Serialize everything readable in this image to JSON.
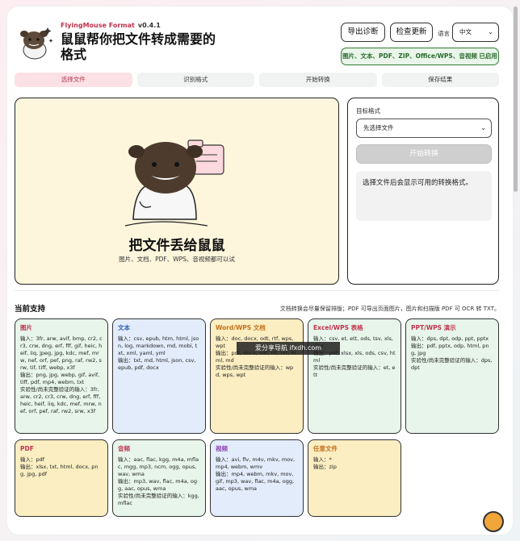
{
  "app": {
    "name": "FlyingMouse Format",
    "version": "v0.4.1",
    "headline": "鼠鼠帮你把文件转成需要的格式"
  },
  "header": {
    "export_label": "导出诊断",
    "update_label": "检查更新",
    "language_label": "语言",
    "language_value": "中文",
    "status": "图片、文本、PDF、ZIP、Office/WPS、音视频 已启用"
  },
  "steps": [
    "选择文件",
    "识别格式",
    "开始转换",
    "保存结果"
  ],
  "dropzone": {
    "title": "把文件丢给鼠鼠",
    "subtitle": "图片、文档、PDF、WPS、音视频都可以试"
  },
  "side": {
    "target_label": "目标格式",
    "select_placeholder": "先选择文件",
    "start_label": "开始转换",
    "hint": "选择文件后会显示可用的转换格式。"
  },
  "support": {
    "title": "当前支持",
    "note": "文档转换会尽量保留排版；PDF 可导出页面图片，图片和扫描版 PDF 可 OCR 转 TXT。",
    "cards": [
      {
        "title": "图片",
        "input": "输入：3fr, arw, avif, bmp, cr2, cr3, crw, dng, erf, fff, gif, heic, heif, iiq, jpeg, jpg, kdc, mef, mrw, nef, orf, pef, png, raf, rw2, srw, tif, tiff, webp, x3f",
        "output": "输出：png, jpg, webp, gif, avif, tiff, pdf, mp4, webm, txt",
        "extra": "实验性/尚未完整验证的输入：3fr, arw, cr2, cr3, crw, dng, erf, fff, heic, heif, iiq, kdc, mef, mrw, nef, orf, pef, raf, rw2, srw, x3f"
      },
      {
        "title": "文本",
        "input": "输入：csv, epub, htm, html, json, log, markdown, md, mobi, txt, xml, yaml, yml",
        "output": "输出：txt, md, html, json, csv, epub, pdf, docx",
        "extra": ""
      },
      {
        "title": "Word/WPS 文档",
        "input": "输入：doc, docx, odt, rtf, wps, wpt",
        "output": "输出：pdf, docx, odt, rtf, txt, html, md",
        "extra": "实验性/尚未完整验证的输入：wpd, wps, wpt"
      },
      {
        "title": "Excel/WPS 表格",
        "input": "输入：csv, et, ett, ods, tsv, xls, xlsx",
        "output": "输出：pdf, xlsx, xls, ods, csv, html",
        "extra": "实验性/尚未完整验证的输入：et, ett"
      },
      {
        "title": "PPT/WPS 演示",
        "input": "输入：dps, dpt, odp, ppt, pptx",
        "output": "输出：pdf, pptx, odp, html, png, jpg",
        "extra": "实验性/尚未完整验证的输入：dps, dpt"
      },
      {
        "title": "PDF",
        "input": "输入：pdf",
        "output": "输出：xlsx, txt, html, docx, png, jpg, pdf",
        "extra": ""
      },
      {
        "title": "音频",
        "input": "输入：aac, flac, kgg, m4a, mflac, mgg, mp3, ncm, ogg, opus, wav, wma",
        "output": "输出：mp3, wav, flac, m4a, ogg, aac, opus, wma",
        "extra": "实验性/尚未完整验证的输入：kgg, mflac"
      },
      {
        "title": "视频",
        "input": "输入：avi, flv, m4v, mkv, mov, mp4, webm, wmv",
        "output": "输出：mp4, webm, mkv, mov, gif, mp3, wav, flac, m4a, ogg, aac, opus, wma",
        "extra": ""
      },
      {
        "title": "任意文件",
        "input": "输入：*",
        "output": "输出：zip",
        "extra": ""
      }
    ]
  },
  "watermark": "爱分享导航 ifxdh.com",
  "colors": {
    "accent": "#c0334d",
    "status_green": "#2e7d32",
    "drop_bg": "#fdf6dc"
  }
}
